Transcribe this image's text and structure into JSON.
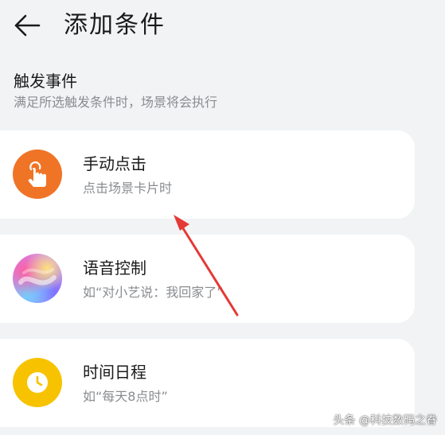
{
  "header": {
    "back_icon": "arrow-left-icon",
    "title": "添加条件"
  },
  "section": {
    "title": "触发事件",
    "description": "满足所选触发条件时，场景将会执行"
  },
  "triggers": [
    {
      "icon": "hand-tap-icon",
      "icon_color": "#f07426",
      "title": "手动点击",
      "subtitle": "点击场景卡片时"
    },
    {
      "icon": "voice-assistant-icon",
      "title": "语音控制",
      "subtitle": "如“对小艺说：我回家了”"
    },
    {
      "icon": "clock-icon",
      "icon_color": "#f7c300",
      "title": "时间日程",
      "subtitle": "如“每天8点时”"
    }
  ],
  "annotation": {
    "arrow_color": "#e53935"
  },
  "watermark": "头条 @科技数码之眷"
}
